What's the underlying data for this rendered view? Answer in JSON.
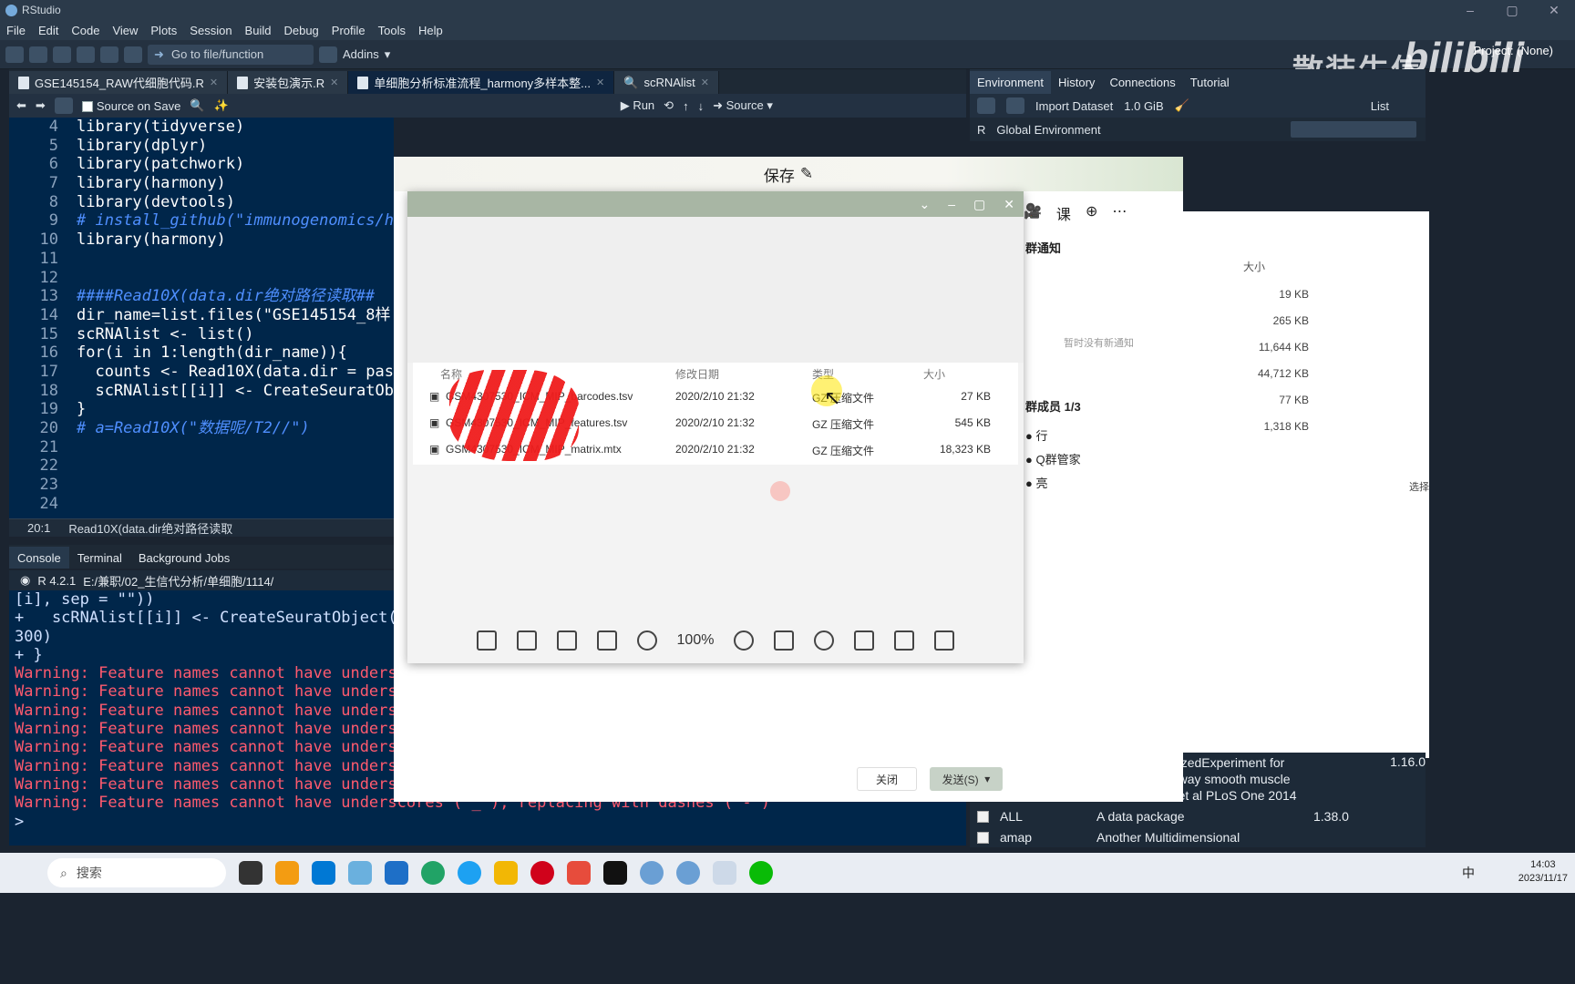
{
  "app": {
    "title": "RStudio",
    "project": "Project: (None)"
  },
  "menu": [
    "File",
    "Edit",
    "Code",
    "View",
    "Plots",
    "Session",
    "Build",
    "Debug",
    "Profile",
    "Tools",
    "Help"
  ],
  "toolbar": {
    "goto": "Go to file/function",
    "addins": "Addins"
  },
  "watermark": {
    "text": "散装生信",
    "brand": "bilibili"
  },
  "editor_tabs": [
    {
      "label": "GSE145154_RAW代细胞代码.R"
    },
    {
      "label": "安装包演示.R"
    },
    {
      "label": "单细胞分析标准流程_harmony多样本整..."
    },
    {
      "label": "scRNAlist"
    }
  ],
  "editor_toolbar": {
    "source_on_save": "Source on Save",
    "run": "Run",
    "source": "Source"
  },
  "editor": {
    "lines": [
      "4",
      "5",
      "6",
      "7",
      "8",
      "9",
      "10",
      "11",
      "12",
      "13",
      "14",
      "15",
      "16",
      "17",
      "18",
      "19",
      "20",
      "21",
      "22",
      "23",
      "24"
    ],
    "code": [
      "library(tidyverse)",
      "library(dplyr)",
      "library(patchwork)",
      "library(harmony)",
      "library(devtools)",
      "# install_github(\"immunogenomics/h",
      "library(harmony)",
      "",
      "",
      "####Read10X(data.dir绝对路径读取##",
      "dir_name=list.files(\"GSE145154_8样",
      "scRNAlist <- list()",
      "for(i in 1:length(dir_name)){",
      "  counts <- Read10X(data.dir = pas",
      "  scRNAlist[[i]] <- CreateSeuratOb",
      "}",
      "# a=Read10X(\"数据呢/T2//\")",
      "",
      "",
      "",
      ""
    ]
  },
  "editor_status": {
    "pos": "20:1",
    "section": "Read10X(data.dir绝对路径读取"
  },
  "console_tabs": [
    "Console",
    "Terminal",
    "Background Jobs"
  ],
  "console_path": {
    "version": "R 4.2.1",
    "path": "E:/兼职/02_生信代分析/单细胞/1114/"
  },
  "console_lines": [
    "[i], sep = \"\"))",
    "+   scRNAlist[[i]] <- CreateSeuratObject(",
    "300)",
    "+ }",
    "Warning: Feature names cannot have unders",
    "Warning: Feature names cannot have unders",
    "Warning: Feature names cannot have unders",
    "Warning: Feature names cannot have unders",
    "Warning: Feature names cannot have unders",
    "Warning: Feature names cannot have unders",
    "Warning: Feature names cannot have unders",
    "Warning: Feature names cannot have underscores ('_'), replacing with dashes ('-')",
    ">"
  ],
  "right_tabs": [
    "Environment",
    "History",
    "Connections",
    "Tutorial"
  ],
  "right_toolbar": {
    "import": "Import Dataset",
    "mem": "1.0 GiB",
    "view": "List",
    "lang": "R",
    "env": "Global Environment"
  },
  "packages": [
    {
      "name": "",
      "desc": "izedExperiment for",
      "desc2": "way smooth muscle",
      "desc3": "et al PLoS One 2014",
      "ver": "1.16.0"
    },
    {
      "name": "ALL",
      "desc": "A data package",
      "ver": "1.38.0"
    },
    {
      "name": "amap",
      "desc": "Another Multidimensional"
    }
  ],
  "explorer": {
    "col_size": "大小",
    "sizes": [
      "19 KB",
      "265 KB",
      "11,644 KB",
      "44,712 KB",
      "77 KB",
      "1,318 KB"
    ],
    "side": "选择"
  },
  "dialog": {
    "title": "保存",
    "cancel": "关闭",
    "send": "发送(S)"
  },
  "viewer": {
    "headers": {
      "name": "名称",
      "date": "修改日期",
      "type": "类型",
      "size": "大小"
    },
    "files": [
      {
        "name": "GSM4307530_ICM_MIP_barcodes.tsv",
        "date": "2020/2/10 21:32",
        "type": "GZ 压缩文件",
        "size": "27 KB"
      },
      {
        "name": "GSM4307530_ICM_MIP_features.tsv",
        "date": "2020/2/10 21:32",
        "type": "GZ 压缩文件",
        "size": "545 KB"
      },
      {
        "name": "GSM4307530_ICM_MIP_matrix.mtx",
        "date": "2020/2/10 21:32",
        "type": "GZ 压缩文件",
        "size": "18,323 KB"
      }
    ],
    "zoom": "100%"
  },
  "chat": {
    "notice": "群通知",
    "empty": "暂时没有新通知",
    "members": "群成员 1/3",
    "member_list": [
      "行",
      "Q群管家",
      "亮"
    ]
  },
  "taskbar": {
    "search": "搜索",
    "time": "14:03",
    "date": "2023/11/17",
    "ime": "中"
  }
}
